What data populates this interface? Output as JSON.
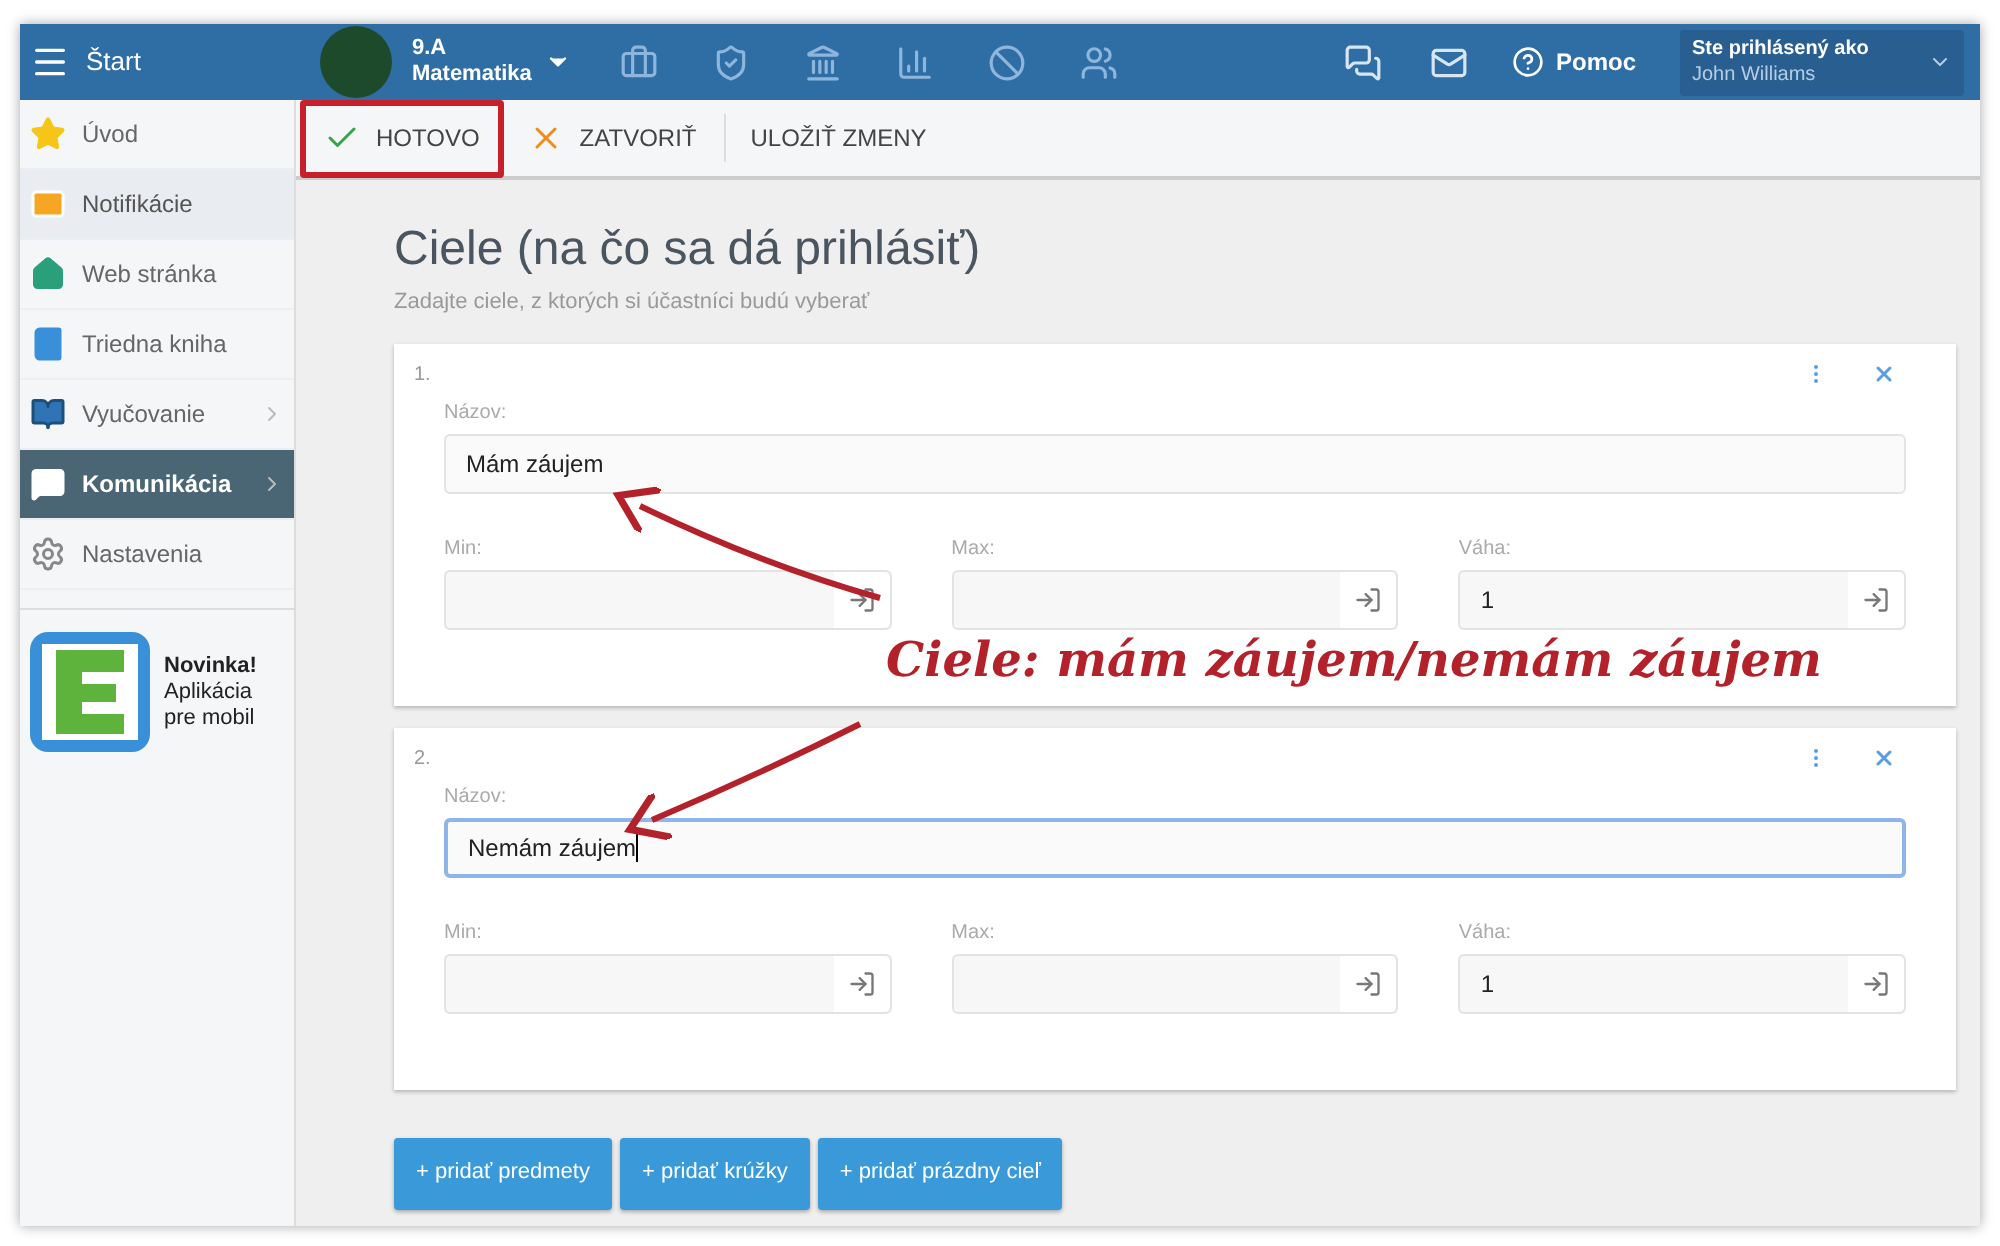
{
  "top_bar": {
    "menu_label": "Štart",
    "class_name": "9.A",
    "subject": "Matematika",
    "help": "Pomoc",
    "user_caption": "Ste prihlásený ako",
    "user_name": "John Williams"
  },
  "sidebar": {
    "items": [
      {
        "label": "Úvod",
        "selected": false,
        "highlighted": false,
        "has_submenu": false
      },
      {
        "label": "Notifikácie",
        "selected": false,
        "highlighted": true,
        "has_submenu": false
      },
      {
        "label": "Web stránka",
        "selected": false,
        "highlighted": false,
        "has_submenu": false
      },
      {
        "label": "Triedna kniha",
        "selected": false,
        "highlighted": false,
        "has_submenu": false
      },
      {
        "label": "Vyučovanie",
        "selected": false,
        "highlighted": false,
        "has_submenu": true
      },
      {
        "label": "Komunikácia",
        "selected": true,
        "highlighted": false,
        "has_submenu": true
      },
      {
        "label": "Nastavenia",
        "selected": false,
        "highlighted": false,
        "has_submenu": false
      }
    ],
    "promo": {
      "title": "Novinka!",
      "text_1": "Aplikácia",
      "text_2": "pre mobil"
    }
  },
  "toolbar": {
    "done": "HOTOVO",
    "close": "ZATVORIŤ",
    "save": "ULOŽIŤ ZMENY",
    "done_outlined": true
  },
  "page": {
    "title": "Ciele (na čo sa dá prihlásiť)",
    "subtitle": "Zadajte ciele, z ktorých si účastníci budú vyberať"
  },
  "goals": [
    {
      "number": "1.",
      "name_label": "Názov:",
      "name": "Mám záujem",
      "focused": false,
      "min_label": "Min:",
      "max_label": "Max:",
      "weight_label": "Váha:",
      "weight": "1"
    },
    {
      "number": "2.",
      "name_label": "Názov:",
      "name": "Nemám záujem",
      "focused": true,
      "min_label": "Min:",
      "max_label": "Max:",
      "weight_label": "Váha:",
      "weight": "1"
    }
  ],
  "buttons": [
    "+ pridať predmety",
    "+ pridať krúžky",
    "+ pridať prázdny cieľ"
  ],
  "annotation": {
    "text": "Ciele: mám záujem/nemám záujem"
  }
}
